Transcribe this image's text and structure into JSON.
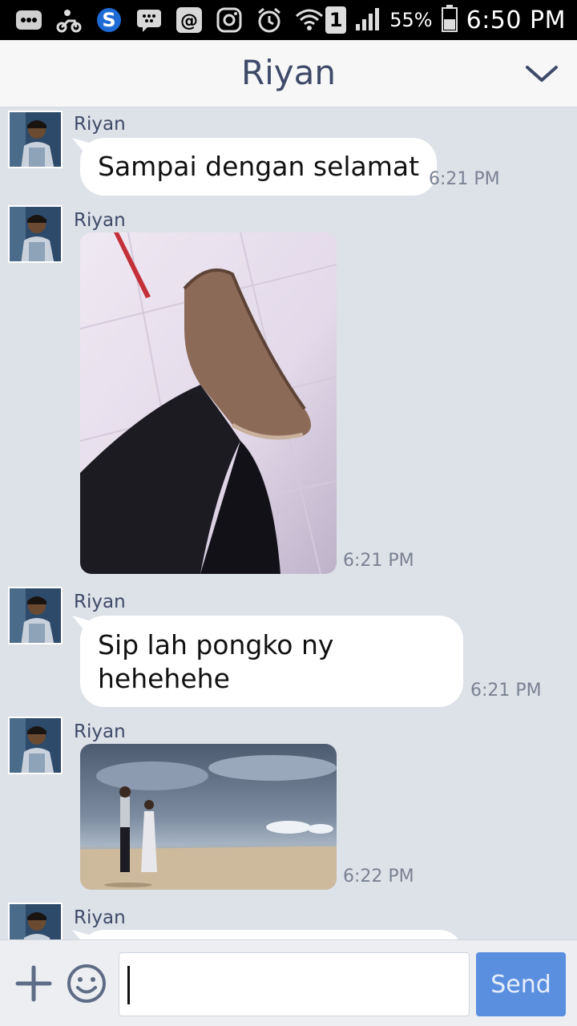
{
  "status_bar": {
    "icons": [
      "bbm-icon",
      "scooter-icon",
      "skype-icon",
      "blackberry-icon",
      "email-icon",
      "instagram-icon",
      "alarm-icon",
      "wifi-icon",
      "sim-icon",
      "signal-icon",
      "battery-icon"
    ],
    "battery_percent": "55%",
    "time": "6:50 PM",
    "sim_number": "1"
  },
  "header": {
    "title": "Riyan",
    "menu_icon": "chevron-down-icon"
  },
  "messages": [
    {
      "sender": "Riyan",
      "type": "text",
      "text": "Sampai dengan selamat",
      "time": "6:21 PM"
    },
    {
      "sender": "Riyan",
      "type": "image",
      "image": "photo of a leg wearing a brown boot",
      "time": "6:21 PM"
    },
    {
      "sender": "Riyan",
      "type": "text",
      "text_lines": [
        "Sip lah pongko ny",
        "hehehehe"
      ],
      "time": "6:21 PM"
    },
    {
      "sender": "Riyan",
      "type": "image",
      "image": "couple walking on a beach under cloudy sky",
      "time": "6:22 PM"
    },
    {
      "sender": "Riyan",
      "type": "text",
      "text": "",
      "time": ""
    }
  ],
  "input": {
    "value": "",
    "placeholder": "",
    "send_label": "Send",
    "plus_icon": "plus-icon",
    "emoji_icon": "smiley-icon"
  },
  "colors": {
    "chat_background": "#dde1e8",
    "header_title": "#3e4a68",
    "send_button": "#5a8fe0",
    "bubble": "#ffffff"
  }
}
